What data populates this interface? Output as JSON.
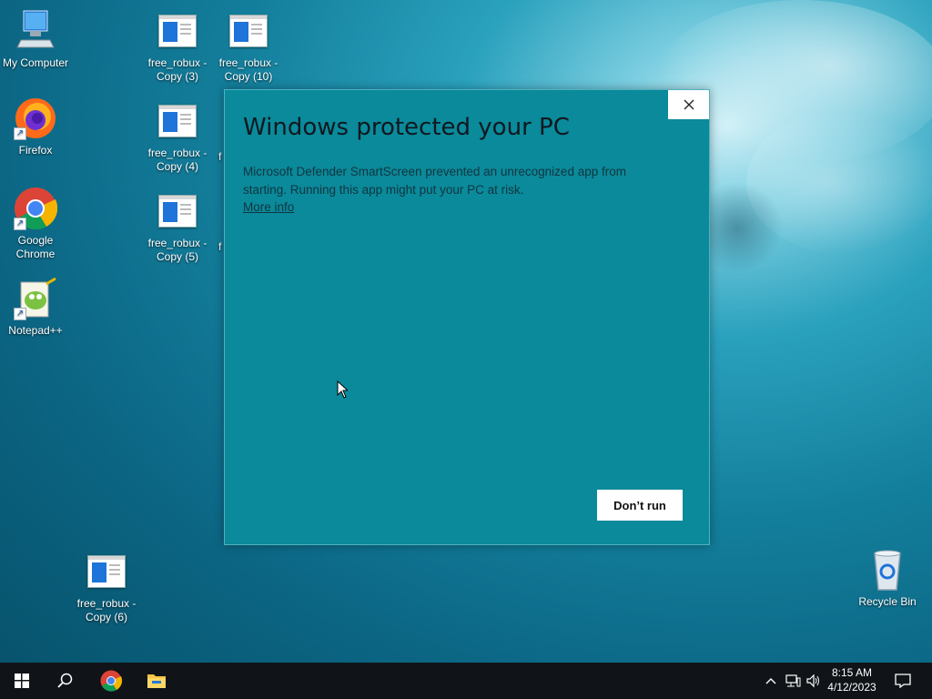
{
  "desktop": {
    "icons_left": [
      {
        "label": "My Computer"
      },
      {
        "label": "Firefox"
      },
      {
        "label": "Google\nChrome"
      },
      {
        "label": "Notepad++"
      }
    ],
    "files": [
      {
        "label": "free_robux -\nCopy (3)"
      },
      {
        "label": "free_robux -\nCopy (10)"
      },
      {
        "label": "free_robux -\nCopy (4)"
      },
      {
        "label": "free_robux -\nCopy (5)"
      },
      {
        "label": "free_robux -\nCopy (6)"
      },
      {
        "label": "f"
      },
      {
        "label": "f"
      }
    ],
    "recycle_bin": {
      "label": "Recycle Bin"
    }
  },
  "dialog": {
    "title": "Windows protected your PC",
    "message": "Microsoft Defender SmartScreen prevented an unrecognized app from starting. Running this app might put your PC at risk.",
    "more_info": "More info",
    "dont_run": "Don’t run",
    "close_icon": "close-icon",
    "background_color": "#0a8a9a"
  },
  "taskbar": {
    "time": "8:15 AM",
    "date": "4/12/2023",
    "icons": [
      "windows-start-icon",
      "search-icon",
      "chrome-icon",
      "file-explorer-icon"
    ],
    "tray_icons": [
      "chevron-up-icon",
      "network-icon",
      "volume-icon",
      "notification-icon"
    ]
  }
}
